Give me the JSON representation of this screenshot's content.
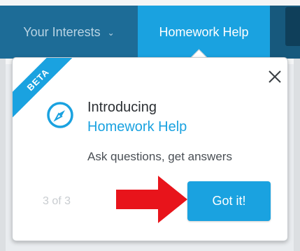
{
  "nav": {
    "interests_label": "Your Interests",
    "homework_label": "Homework Help"
  },
  "popup": {
    "badge": "BETA",
    "intro": "Introducing",
    "product": "Homework Help",
    "subtitle": "Ask questions, get answers",
    "step": "3 of 3",
    "button_label": "Got it!",
    "icons": {
      "close": "close-icon",
      "compass": "compass-icon",
      "arrow": "red-arrow-icon",
      "chevron": "chevron-down-icon"
    }
  },
  "colors": {
    "nav_bg": "#1d6c97",
    "accent": "#1aa2e0",
    "arrow": "#e8141b"
  }
}
